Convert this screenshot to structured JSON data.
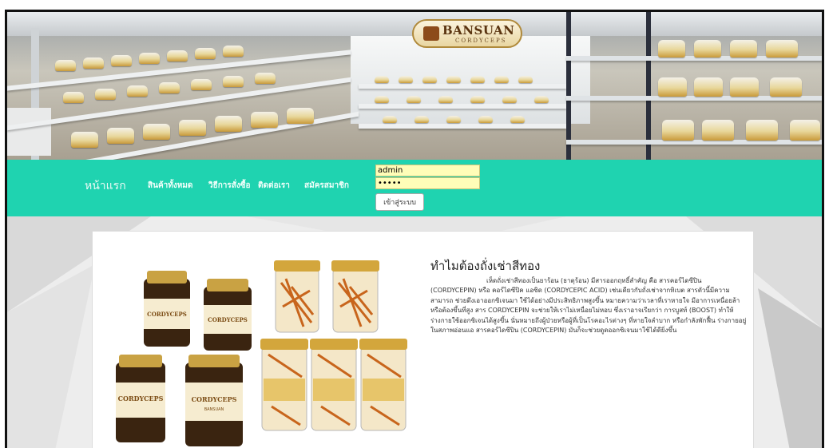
{
  "banner": {
    "logo_name": "BANSUAN",
    "logo_sub": "CORDYCEPS"
  },
  "nav": {
    "items": [
      "หน้าแรก",
      "สินค้าทั้งหมด",
      "วิธีการสั่งซื้อ",
      "ติดต่อเรา",
      "สมัครสมาชิก"
    ],
    "login": {
      "username_value": "admin",
      "password_value": "•••••",
      "button_label": "เข้าสู่ระบบ"
    }
  },
  "article": {
    "title": "ทำไมต้องถั่งเช่าสีทอง",
    "body": "เห็ดถั่งเช่าสีทองเป็นยาร้อน (ธาตุร้อน) มีสารออกฤทธิ์สำคัญ คือ สารคอร์ไดซีปิน (CORDYCEPIN) หรือ คอร์ไดซีปิค แอซิด (CORDYCEPIC ACID) เช่นเดียวกับถั่งเช่าจากทิเบต สารตัวนี้มีความสามารถ ช่วยดึงเอาออกซิเจนมา ใช้ได้อย่างมีประสิทธิภาพสูงขึ้น หมายความว่าเวลาที่เราหายใจ มีอาการเหนื่อยล้า หรือต้องขึ้นที่สูง สาร CORDYCEPIN จะช่วยให้เราไม่เหนื่อยไม่หอบ ซึ่งเราอาจเรียกว่า การบูสท์ (BOOST) ทำให้ร่างกายใช้ออกซิเจนได้สูงขึ้น นั่นหมายถึงผู้ป่วยหรือผู้ที่เป็นโรคอะไรต่างๆ ที่หายใจลำบาก หรือกำลังพักฟื้น ร่างกายอยู่ในสภาพอ่อนแอ สารคอร์ไดซีปิน (CORDYCEPIN) มันก็จะช่วยดูดออกซิเจนมาใช้ได้ดียิ่งขึ้น"
  },
  "product_labels": {
    "bottle": "CORDYCEPS",
    "brand": "BANSUAN"
  },
  "colors": {
    "nav_bg": "#1fd3b0",
    "login_field_bg": "#fffdb8",
    "logo_gold": "#b08a3c"
  }
}
